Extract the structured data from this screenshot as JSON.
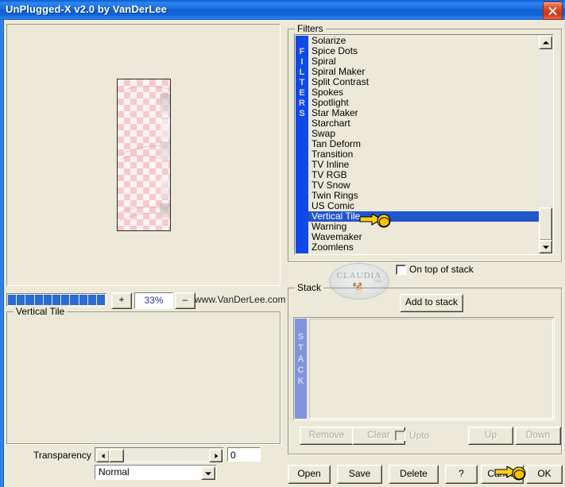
{
  "window": {
    "title": "UnPlugged-X v2.0 by VanDerLee",
    "close_label": "close-icon",
    "accent_title": "#0A62D6",
    "face_color": "#ECE9D8",
    "selection_color": "#2255CC"
  },
  "preview": {
    "zoom_value": "33%",
    "zoom_in_label": "+",
    "zoom_out_label": "–",
    "website": "www.VanDerLee.com",
    "zoom_blocks": 11
  },
  "filter_params": {
    "group_label": "Vertical Tile",
    "transparency_label": "Transparency",
    "transparency_value": "0",
    "blend_mode": "Normal"
  },
  "filters": {
    "group_label": "Filters",
    "band_label": "FILTERS",
    "selected": "Vertical Tile",
    "items": [
      "Solarize",
      "Spice Dots",
      "Spiral",
      "Spiral Maker",
      "Split Contrast",
      "Spokes",
      "Spotlight",
      "Star Maker",
      "Starchart",
      "Swap",
      "Tan Deform",
      "Transition",
      "TV Inline",
      "TV RGB",
      "TV Snow",
      "Twin Rings",
      "US Comic",
      "Vertical Tile",
      "Warning",
      "Wavemaker",
      "Zoomlens"
    ],
    "on_top_label": "On top of stack",
    "on_top_checked": false
  },
  "watermark": {
    "text": "CLAUDIA",
    "subtext": "tuts"
  },
  "stack": {
    "group_label": "Stack",
    "band_label": "STACK",
    "add_label": "Add to stack",
    "items": [],
    "buttons": [
      {
        "label": "Remove",
        "enabled": false
      },
      {
        "label": "Clear",
        "enabled": false
      },
      {
        "label": "Up",
        "enabled": false
      },
      {
        "label": "Down",
        "enabled": false
      }
    ],
    "upto_label": "Upto",
    "upto_checked": false
  },
  "dialog_buttons": [
    {
      "label": "Open"
    },
    {
      "label": "Save"
    },
    {
      "label": "Delete"
    },
    {
      "label": "?"
    },
    {
      "label": "Cancel"
    },
    {
      "label": "OK"
    }
  ]
}
